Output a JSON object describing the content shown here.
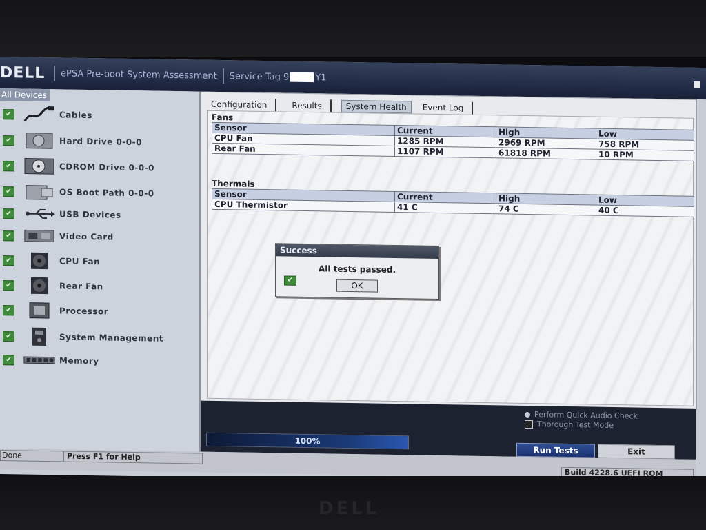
{
  "header": {
    "logo": "DELL",
    "title": "ePSA Pre-boot System Assessment",
    "service_tag_prefix": "Service Tag 9",
    "service_tag_suffix": "Y1"
  },
  "sidebar": {
    "root_label": "All Devices",
    "items": [
      {
        "label": "Cables",
        "icon": "cable-icon"
      },
      {
        "label": "Hard Drive 0-0-0",
        "icon": "hard-drive-icon"
      },
      {
        "label": "CDROM Drive 0-0-0",
        "icon": "cdrom-icon"
      },
      {
        "label": "OS Boot Path 0-0-0",
        "icon": "boot-path-icon"
      },
      {
        "label": "USB Devices",
        "icon": "usb-icon"
      },
      {
        "label": "Video Card",
        "icon": "video-card-icon"
      },
      {
        "label": "CPU Fan",
        "icon": "fan-icon"
      },
      {
        "label": "Rear Fan",
        "icon": "fan-icon"
      },
      {
        "label": "Processor",
        "icon": "processor-icon"
      },
      {
        "label": "System Management",
        "icon": "system-management-icon"
      },
      {
        "label": "Memory",
        "icon": "memory-icon"
      }
    ]
  },
  "tabs": [
    {
      "label": "Configuration",
      "active": false
    },
    {
      "label": "Results",
      "active": false
    },
    {
      "label": "System Health",
      "active": true
    },
    {
      "label": "Event Log",
      "active": false
    }
  ],
  "fans": {
    "title": "Fans",
    "headers": [
      "Sensor",
      "Current",
      "High",
      "Low"
    ],
    "rows": [
      [
        "CPU Fan",
        "1285 RPM",
        "2969 RPM",
        "758 RPM"
      ],
      [
        "Rear Fan",
        "1107 RPM",
        "61818 RPM",
        "10 RPM"
      ]
    ]
  },
  "thermals": {
    "title": "Thermals",
    "headers": [
      "Sensor",
      "Current",
      "High",
      "Low"
    ],
    "rows": [
      [
        "CPU Thermistor",
        "41 C",
        "74 C",
        "40 C"
      ]
    ]
  },
  "dialog": {
    "title": "Success",
    "message": "All tests passed.",
    "ok_label": "OK"
  },
  "progress": {
    "percent_value": 1.0,
    "label": "100%"
  },
  "options": {
    "quick_audio": "Perform Quick Audio Check",
    "thorough_mode": "Thorough Test Mode"
  },
  "buttons": {
    "run_tests": "Run Tests",
    "exit": "Exit"
  },
  "status": {
    "state": "Done",
    "help": "Press F1 for Help",
    "build": "Build  4228.6 UEFI ROM"
  },
  "colors": {
    "titlebar": "#202a44",
    "check_green": "#3f8b3b",
    "run_button": "#1b3170"
  }
}
